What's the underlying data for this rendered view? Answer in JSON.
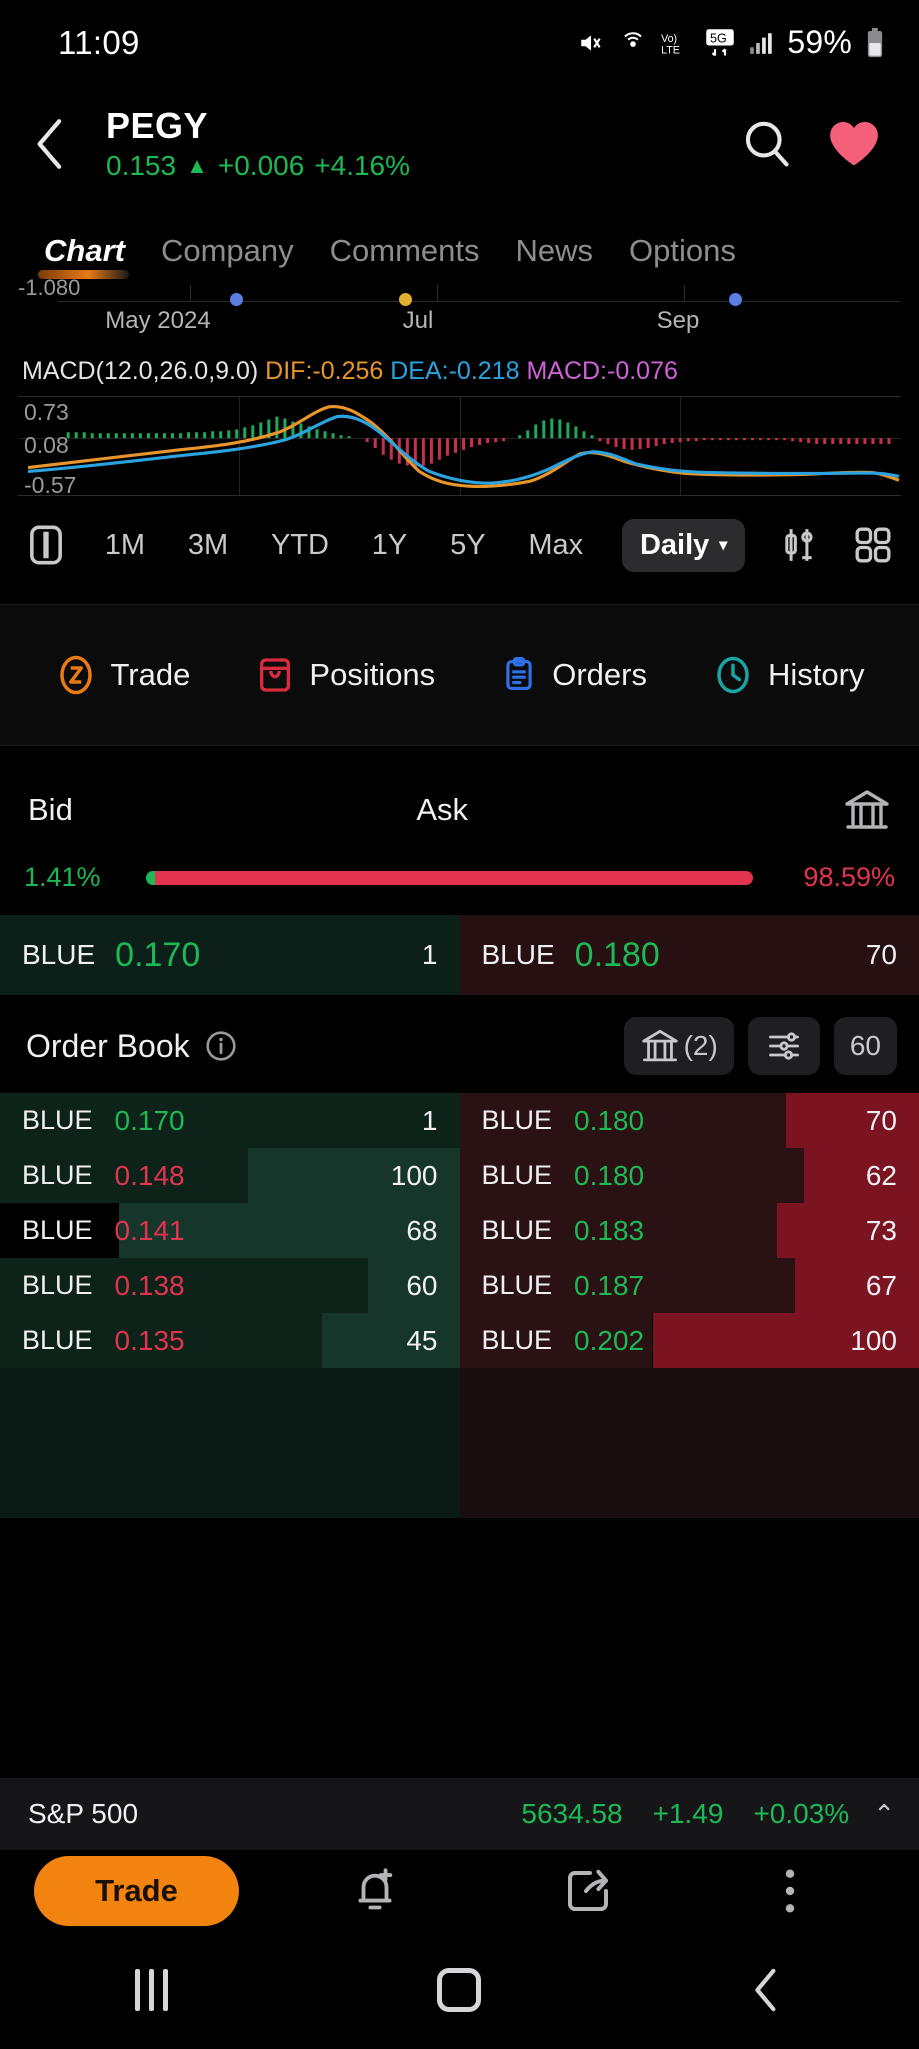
{
  "status_bar": {
    "time": "11:09",
    "battery_percent": "59%",
    "icons": [
      "mute-icon",
      "hotspot-icon",
      "volte-icon",
      "5g-icon",
      "signal-icon",
      "battery-icon"
    ]
  },
  "header": {
    "back_icon": "back-chevron-icon",
    "symbol": "PEGY",
    "price": "0.153",
    "arrow": "▲",
    "change": "+0.006",
    "change_percent": "+4.16%",
    "search_icon": "search-icon",
    "favorite_icon": "heart-icon",
    "up_color": "#1db954",
    "favorite_color": "#f4607a"
  },
  "tabs": [
    {
      "label": "Chart",
      "active": true
    },
    {
      "label": "Company",
      "active": false
    },
    {
      "label": "Comments",
      "active": false
    },
    {
      "label": "News",
      "active": false
    },
    {
      "label": "Options",
      "active": false
    }
  ],
  "price_chart_strip": {
    "axis_label": "-1.080",
    "months": [
      "May 2024",
      "Jul",
      "Sep"
    ],
    "event_dots": [
      "#5b7fe0",
      "#e0b030",
      "#5b7fe0"
    ]
  },
  "macd": {
    "title": "MACD(12.0,26.0,9.0)",
    "dif_label": "DIF:-0.256",
    "dea_label": "DEA:-0.218",
    "macd_label": "MACD:-0.076",
    "dif_color": "#e8952b",
    "dea_color": "#2aa3e0",
    "macd_color": "#cf62d6",
    "y_top": "0.73",
    "y_mid": "0.08",
    "y_bottom": "-0.57"
  },
  "timeframes": {
    "chart_type_icon": "candle-toggle-icon",
    "ranges": [
      "1M",
      "3M",
      "YTD",
      "1Y",
      "5Y",
      "Max"
    ],
    "interval_label": "Daily",
    "interval_caret": "▾",
    "indicator_icon": "candlestick-settings-icon",
    "grid_icon": "grid-icon"
  },
  "action_row": [
    {
      "label": "Trade",
      "icon": "trade-icon",
      "color": "#e87b16"
    },
    {
      "label": "Positions",
      "icon": "positions-icon",
      "color": "#d92b3e"
    },
    {
      "label": "Orders",
      "icon": "orders-icon",
      "color": "#2f6fe8"
    },
    {
      "label": "History",
      "icon": "history-clock-icon",
      "color": "#1aa5a5"
    }
  ],
  "bid_ask": {
    "bid_label": "Bid",
    "ask_label": "Ask",
    "exchange_icon": "exchange-bank-icon",
    "bid_ratio": "1.41%",
    "ask_ratio": "98.59%",
    "bid_ratio_value": 1.41,
    "ask_ratio_value": 98.59,
    "top_bid": {
      "venue": "BLUE",
      "price": "0.170",
      "size": "1"
    },
    "top_ask": {
      "venue": "BLUE",
      "price": "0.180",
      "size": "70"
    }
  },
  "order_book": {
    "title": "Order Book",
    "info_icon": "info-icon",
    "exchange_btn_label": "(2)",
    "exchange_btn_icon": "exchange-bank-icon",
    "settings_icon": "sliders-icon",
    "depth_label": "60",
    "bids": [
      {
        "venue": "BLUE",
        "price": "0.170",
        "size": "1",
        "price_up": true,
        "outer_pct": 0,
        "inner_pct": 100
      },
      {
        "venue": "BLUE",
        "price": "0.148",
        "size": "100",
        "price_up": false,
        "outer_pct": 46,
        "inner_pct": 54
      },
      {
        "venue": "BLUE",
        "price": "0.141",
        "size": "68",
        "price_up": false,
        "outer_pct": 26,
        "inner_pct": 0
      },
      {
        "venue": "BLUE",
        "price": "0.138",
        "size": "60",
        "price_up": false,
        "outer_pct": 20,
        "inner_pct": 80
      },
      {
        "venue": "BLUE",
        "price": "0.135",
        "size": "45",
        "price_up": false,
        "outer_pct": 11,
        "inner_pct": 70
      }
    ],
    "asks": [
      {
        "venue": "BLUE",
        "price": "0.180",
        "size": "70",
        "price_up": true,
        "outer_pct": 29,
        "inner_pct": 71
      },
      {
        "venue": "BLUE",
        "price": "0.180",
        "size": "62",
        "price_up": true,
        "outer_pct": 25,
        "inner_pct": 75
      },
      {
        "venue": "BLUE",
        "price": "0.183",
        "size": "73",
        "price_up": true,
        "outer_pct": 31,
        "inner_pct": 69
      },
      {
        "venue": "BLUE",
        "price": "0.187",
        "size": "67",
        "price_up": true,
        "outer_pct": 27,
        "inner_pct": 73
      },
      {
        "venue": "BLUE",
        "price": "0.202",
        "size": "100",
        "price_up": true,
        "outer_pct": 58,
        "inner_pct": 42
      }
    ]
  },
  "index_bar": {
    "name": "S&P 500",
    "value": "5634.58",
    "change": "+1.49",
    "change_percent": "+0.03%",
    "expand_caret": "⌃",
    "up_color": "#1db954"
  },
  "bottom_bar": {
    "trade_label": "Trade",
    "trade_color": "#f2830f",
    "alert_icon": "bell-plus-icon",
    "share_icon": "share-icon",
    "more_icon": "more-vertical-icon"
  },
  "android_nav": {
    "recents_icon": "recents-icon",
    "home_icon": "home-icon",
    "back_icon": "nav-back-icon"
  }
}
